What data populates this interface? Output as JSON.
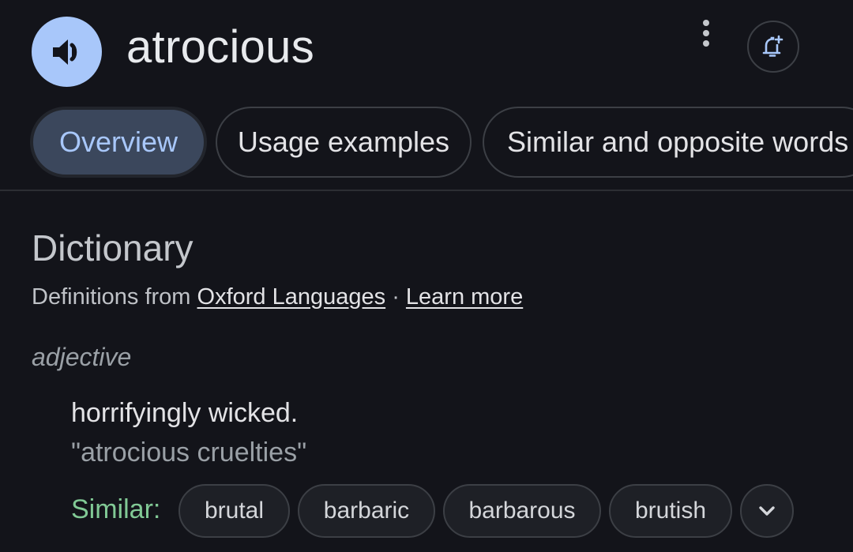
{
  "header": {
    "word": "atrocious",
    "speaker_icon": "volume-icon",
    "more_icon": "more-vertical-icon",
    "alert_icon": "bell-add-icon"
  },
  "tabs": [
    {
      "label": "Overview",
      "active": true
    },
    {
      "label": "Usage examples",
      "active": false
    },
    {
      "label": "Similar and opposite words",
      "active": false
    }
  ],
  "dictionary": {
    "heading": "Dictionary",
    "source_prefix": "Definitions from ",
    "source_link": "Oxford Languages",
    "separator": " · ",
    "learn_more": "Learn more",
    "part_of_speech": "adjective",
    "definition": "horrifyingly wicked.",
    "example": "\"atrocious cruelties\"",
    "similar_label": "Similar:",
    "similar_words": [
      "brutal",
      "barbaric",
      "barbarous",
      "brutish"
    ],
    "expand_icon": "chevron-down-icon"
  },
  "colors": {
    "background": "#13141a",
    "accent": "#a8c7fa",
    "similar_label": "#81c995",
    "active_tab_bg": "#3b475c"
  }
}
